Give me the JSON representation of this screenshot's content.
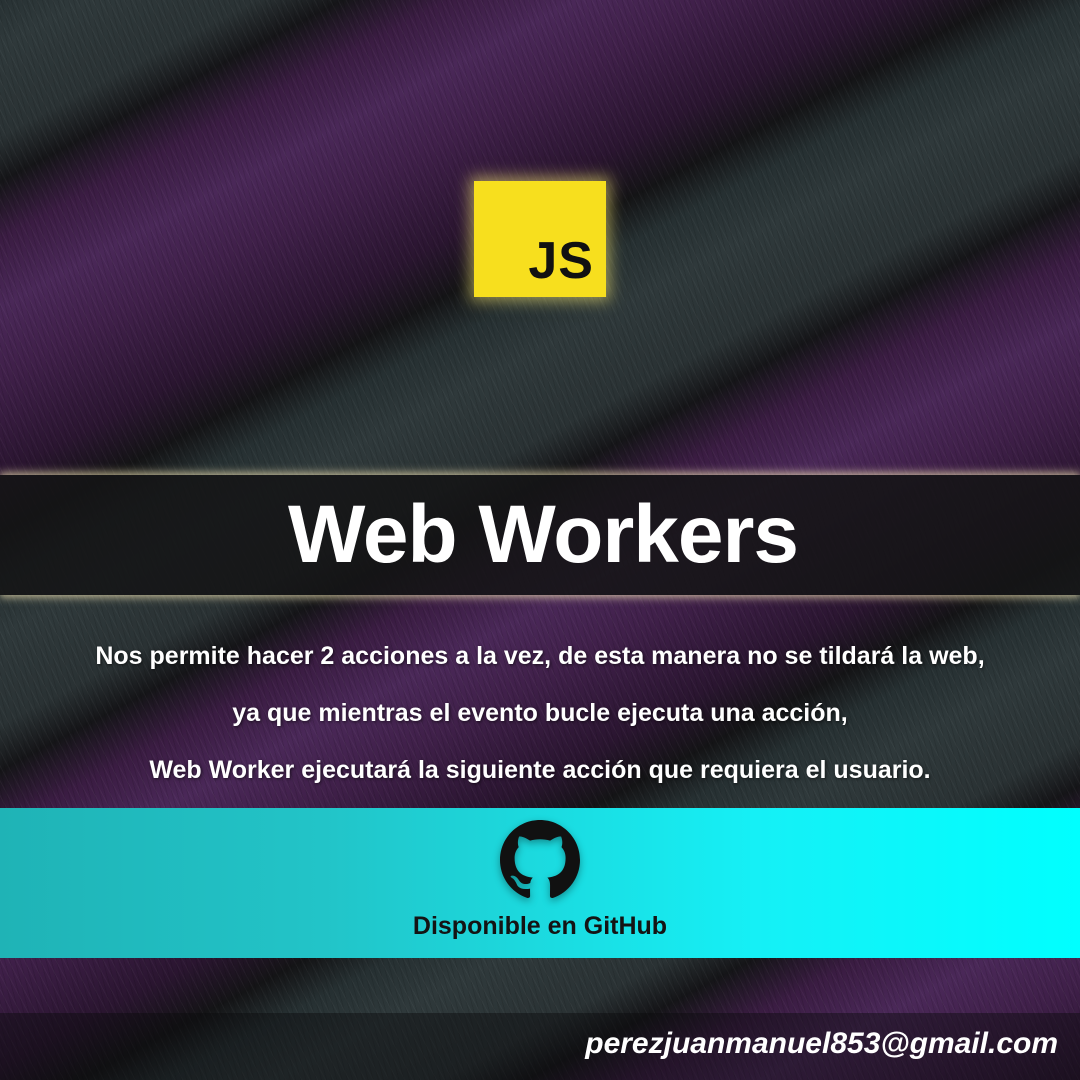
{
  "logo": {
    "text": "JS",
    "color": "#f7df1e",
    "icon": "javascript-logo-icon"
  },
  "title": "Web Workers",
  "description": [
    "Nos permite hacer 2 acciones a la vez, de esta manera no se tildará la web,",
    "ya que mientras el evento bucle ejecuta una acción,",
    "Web Worker ejecutará la siguiente acción que requiera el usuario."
  ],
  "github": {
    "icon": "github-icon",
    "label": "Disponible en GitHub",
    "band_color": "#00ffff"
  },
  "email": "perezjuanmanuel853@gmail.com"
}
